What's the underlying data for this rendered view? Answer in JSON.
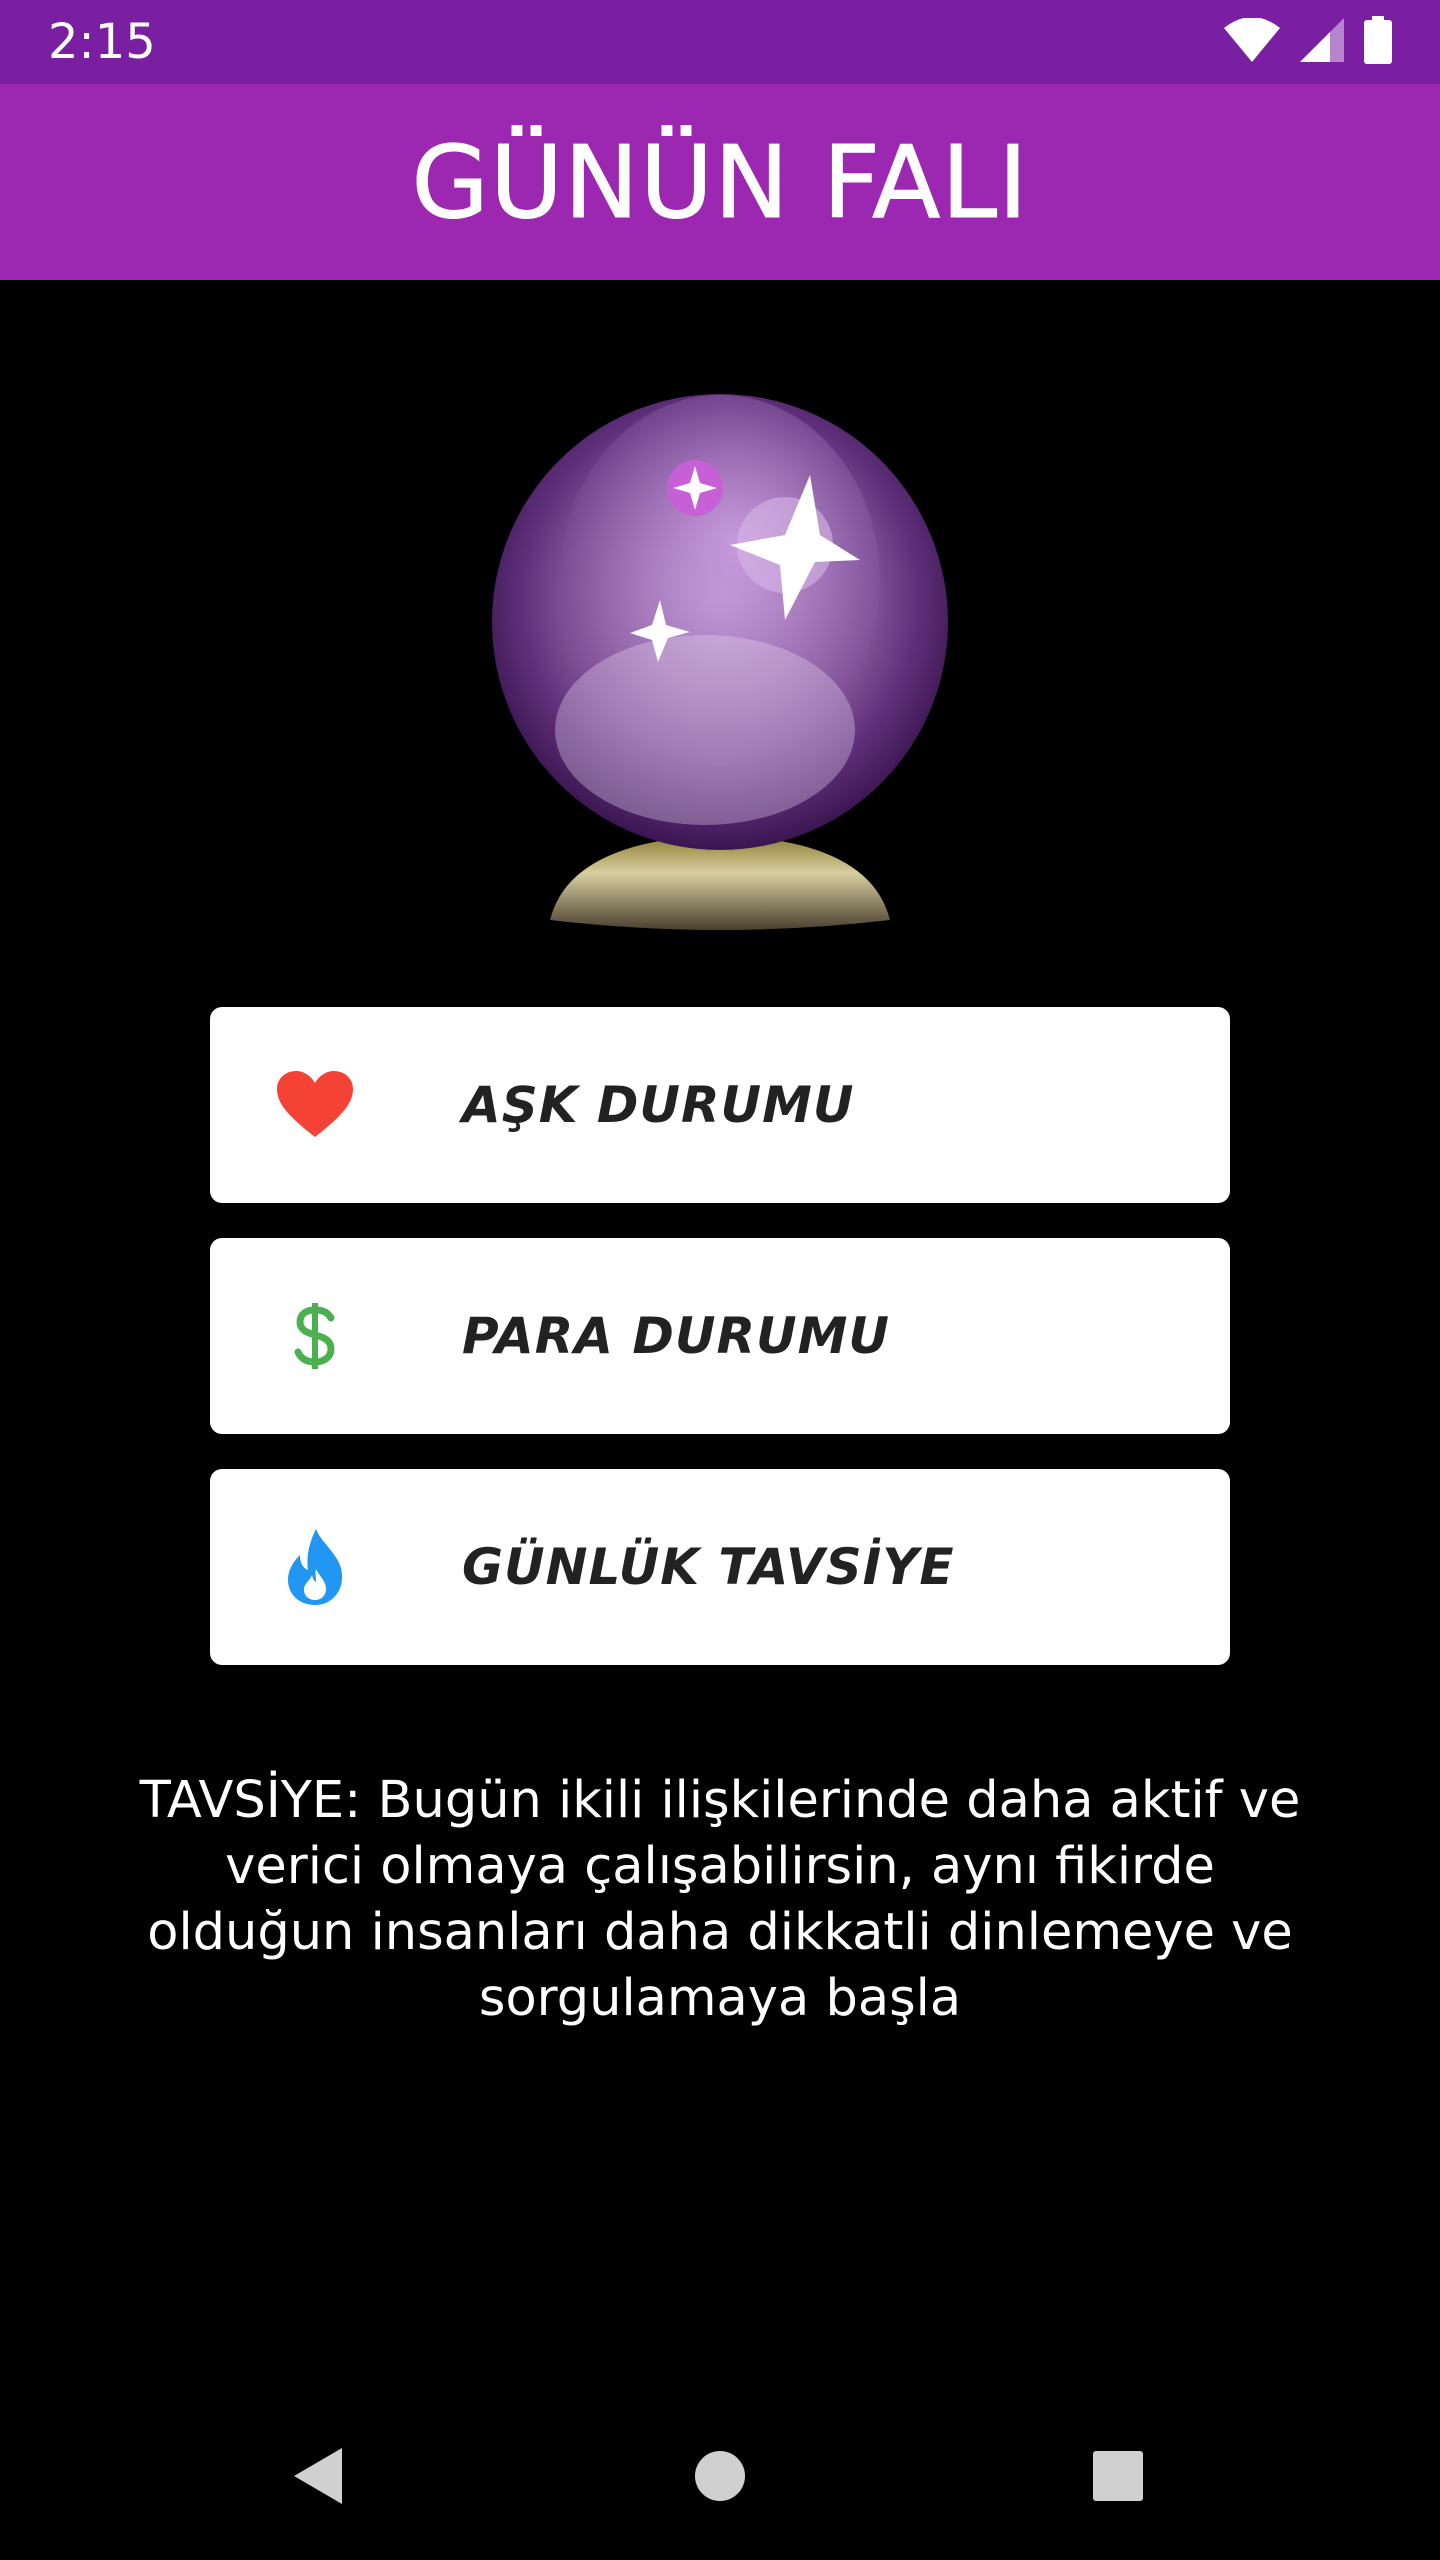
{
  "status_bar": {
    "time": "2:15",
    "background": "#7b1fa2",
    "icons": [
      "wifi-icon",
      "cellular-signal-icon",
      "battery-icon"
    ]
  },
  "app_bar": {
    "title": "GÜNÜN FALI",
    "background": "#9c27b0"
  },
  "hero": {
    "icon": "crystal-ball-icon"
  },
  "buttons": [
    {
      "label": "AŞK DURUMU",
      "icon": "heart-icon",
      "icon_color": "#f44336"
    },
    {
      "label": "PARA DURUMU",
      "icon": "dollar-icon",
      "icon_color": "#4caf50"
    },
    {
      "label": "GÜNLÜK TAVSİYE",
      "icon": "flame-icon",
      "icon_color": "#2196f3"
    }
  ],
  "advice": {
    "text": "TAVSİYE: Bugün ikili ilişkilerinde daha aktif ve verici olmaya çalışabilirsin, aynı fikirde olduğun insanları daha dikkatli dinlemeye ve sorgulamaya başla"
  },
  "nav_bar": {
    "icons": [
      "back-icon",
      "home-icon",
      "recents-icon"
    ]
  }
}
